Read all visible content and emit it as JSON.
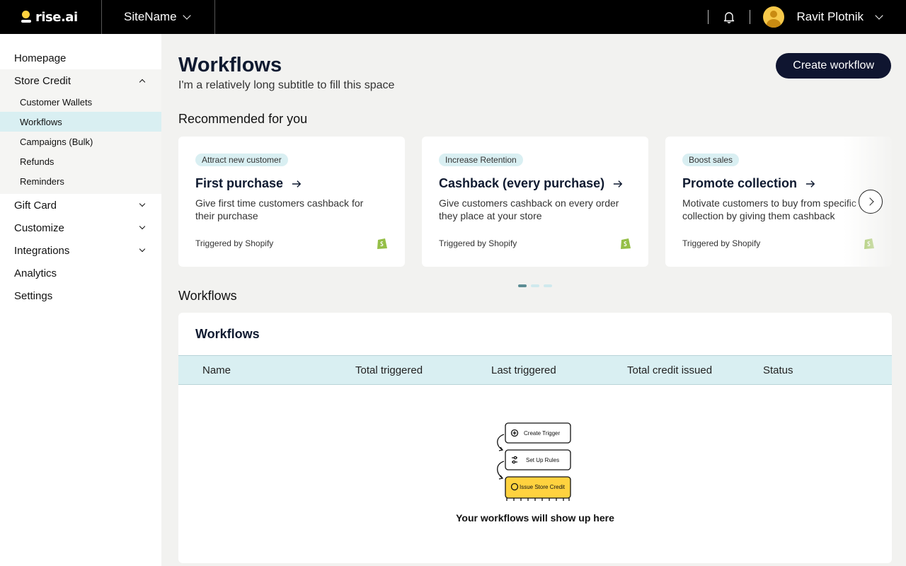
{
  "app": {
    "logo_text": "rise.ai",
    "site_name": "SiteName",
    "user_name": "Ravit Plotnik"
  },
  "sidebar": {
    "homepage": "Homepage",
    "store_credit": "Store Credit",
    "store_credit_items": [
      "Customer Wallets",
      "Workflows",
      "Campaigns (Bulk)",
      "Refunds",
      "Reminders"
    ],
    "gift_card": "Gift Card",
    "customize": "Customize",
    "integrations": "Integrations",
    "analytics": "Analytics",
    "settings": "Settings"
  },
  "page": {
    "title": "Workflows",
    "subtitle": "I'm a relatively long subtitle to fill this space",
    "create_button": "Create workflow",
    "recommended_title": "Recommended for you",
    "workflows_section_title": "Workflows"
  },
  "cards": [
    {
      "tag": "Attract new customer",
      "title": "First purchase",
      "desc1": "Give first time customers cashback for",
      "desc2": "their purchase",
      "trigger": "Triggered by Shopify"
    },
    {
      "tag": "Increase Retention",
      "title": "Cashback (every purchase)",
      "desc1": "Give customers cashback on every order",
      "desc2": "they place at your store",
      "trigger": "Triggered by Shopify"
    },
    {
      "tag": "Boost sales",
      "title": "Promote collection",
      "desc1": "Motivate customers to buy from specific",
      "desc2": "collection by giving them cashback",
      "trigger": "Triggered by Shopify"
    }
  ],
  "table": {
    "title": "Workflows",
    "columns": [
      "Name",
      "Total triggered",
      "Last triggered",
      "Total credit issued",
      "Status"
    ],
    "empty_text": "Your workflows will show up here",
    "illustration": {
      "step1": "Create Trigger",
      "step2": "Set Up Rules",
      "step3": "Issue Store Credit"
    }
  },
  "colors": {
    "accent": "#d9eff2",
    "dark": "#0f1530",
    "yellow": "#ffd23f",
    "shopify": "#95bf47"
  }
}
